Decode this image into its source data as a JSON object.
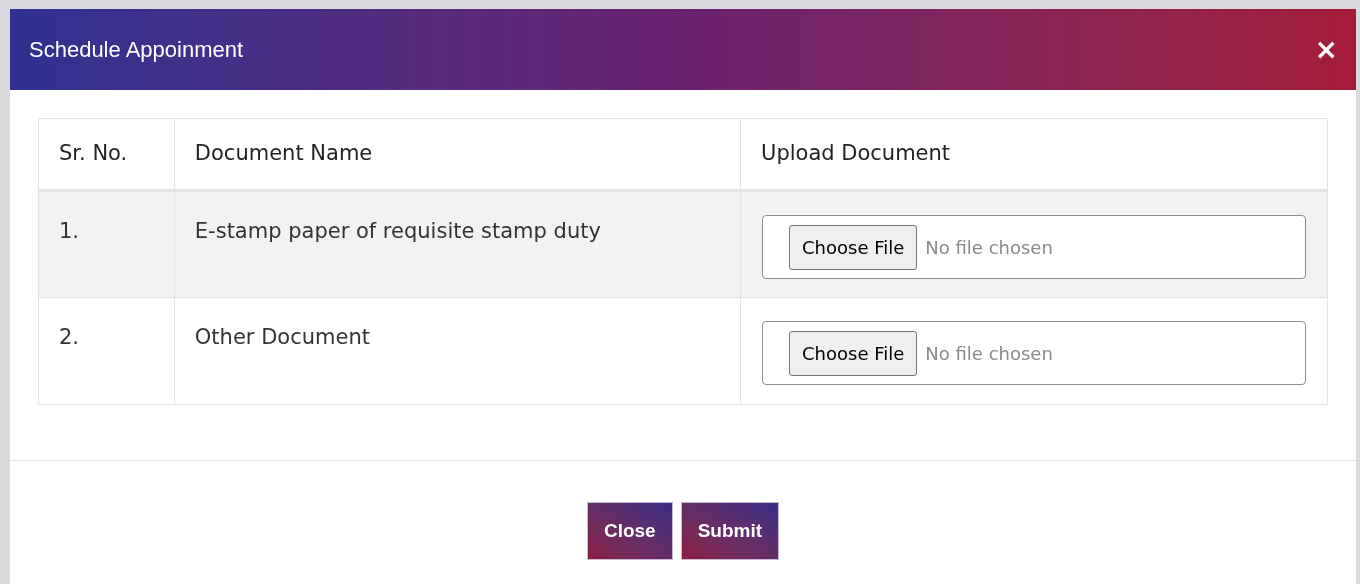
{
  "dialog": {
    "title": "Schedule Appoinment",
    "close_glyph": "×"
  },
  "table": {
    "columns": [
      "Sr. No.",
      "Document Name",
      "Upload Document"
    ],
    "rows": [
      {
        "number": "1.",
        "document": "E-stamp paper of requisite stamp duty",
        "upload_button": "Choose File",
        "file_status": "No file chosen",
        "shaded": true
      },
      {
        "number": "2.",
        "document": "Other Document",
        "upload_button": "Choose File",
        "file_status": "No file chosen",
        "shaded": false
      }
    ]
  },
  "footer_buttons": [
    "Close",
    "Submit"
  ]
}
